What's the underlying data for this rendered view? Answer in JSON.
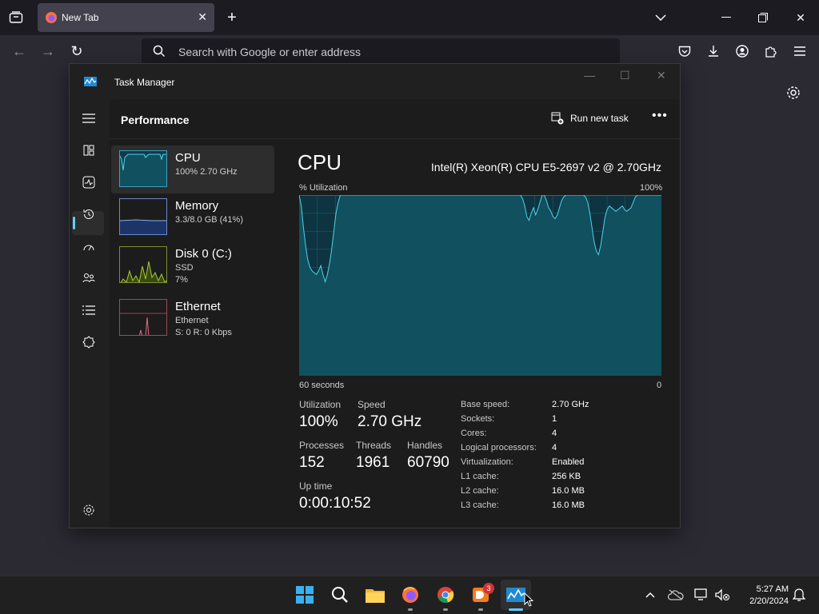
{
  "browser": {
    "tab_title": "New Tab",
    "url_placeholder": "Search with Google or enter address"
  },
  "task_manager": {
    "window_title": "Task Manager",
    "page_title": "Performance",
    "run_new_task": "Run new task",
    "resources": [
      {
        "name": "CPU",
        "line1": "100%  2.70 GHz",
        "line2": ""
      },
      {
        "name": "Memory",
        "line1": "3.3/8.0 GB (41%)",
        "line2": ""
      },
      {
        "name": "Disk 0 (C:)",
        "line1": "SSD",
        "line2": "7%"
      },
      {
        "name": "Ethernet",
        "line1": "Ethernet",
        "line2": "S: 0  R: 0 Kbps"
      }
    ],
    "cpu": {
      "title": "CPU",
      "model": "Intel(R) Xeon(R) CPU E5-2697 v2 @ 2.70GHz",
      "graph_label": "% Utilization",
      "graph_max": "100%",
      "graph_time": "60 seconds",
      "graph_min": "0",
      "stats": {
        "utilization_label": "Utilization",
        "utilization": "100%",
        "speed_label": "Speed",
        "speed": "2.70 GHz",
        "processes_label": "Processes",
        "processes": "152",
        "threads_label": "Threads",
        "threads": "1961",
        "handles_label": "Handles",
        "handles": "60790",
        "uptime_label": "Up time",
        "uptime": "0:00:10:52"
      },
      "specs": [
        {
          "k": "Base speed:",
          "v": "2.70 GHz"
        },
        {
          "k": "Sockets:",
          "v": "1"
        },
        {
          "k": "Cores:",
          "v": "4"
        },
        {
          "k": "Logical processors:",
          "v": "4"
        },
        {
          "k": "Virtualization:",
          "v": "Enabled"
        },
        {
          "k": "L1 cache:",
          "v": "256 KB"
        },
        {
          "k": "L2 cache:",
          "v": "16.0 MB"
        },
        {
          "k": "L3 cache:",
          "v": "16.0 MB"
        }
      ],
      "utilization_history": [
        100,
        94,
        82,
        72,
        64,
        60,
        58,
        57,
        56,
        58,
        61,
        56,
        52,
        56,
        62,
        70,
        80,
        90,
        96,
        100,
        100,
        100,
        100,
        100,
        100,
        100,
        100,
        100,
        100,
        100,
        100,
        100,
        100,
        100,
        100,
        100,
        100,
        100,
        100,
        100,
        100,
        100,
        100,
        100,
        100,
        100,
        100,
        100,
        100,
        100,
        100,
        100,
        100,
        100,
        100,
        100,
        100,
        100,
        100,
        100,
        100,
        100,
        100,
        100,
        100,
        100,
        100,
        100,
        100,
        100,
        100,
        100,
        100,
        100,
        100,
        100,
        100,
        100,
        100,
        100,
        100,
        100,
        100,
        100,
        100,
        100,
        100,
        100,
        100,
        100,
        100,
        100,
        100,
        100,
        100,
        100,
        100,
        100,
        100,
        100,
        100,
        100,
        100,
        98,
        94,
        88,
        86,
        90,
        93,
        89,
        92,
        96,
        100,
        100,
        97,
        93,
        91,
        88,
        87,
        89,
        93,
        97,
        99,
        100,
        100,
        100,
        100,
        100,
        100,
        100,
        100,
        100,
        99,
        96,
        90,
        82,
        74,
        69,
        67,
        72,
        80,
        88,
        92,
        94,
        93,
        92,
        91,
        92,
        93,
        94,
        92,
        91,
        92,
        93,
        96,
        99,
        100,
        100,
        100,
        100,
        100,
        100,
        100,
        100,
        100,
        100,
        100,
        100
      ]
    }
  },
  "taskbar": {
    "time": "5:27 AM",
    "date": "2/20/2024",
    "mail_badge": "3"
  }
}
